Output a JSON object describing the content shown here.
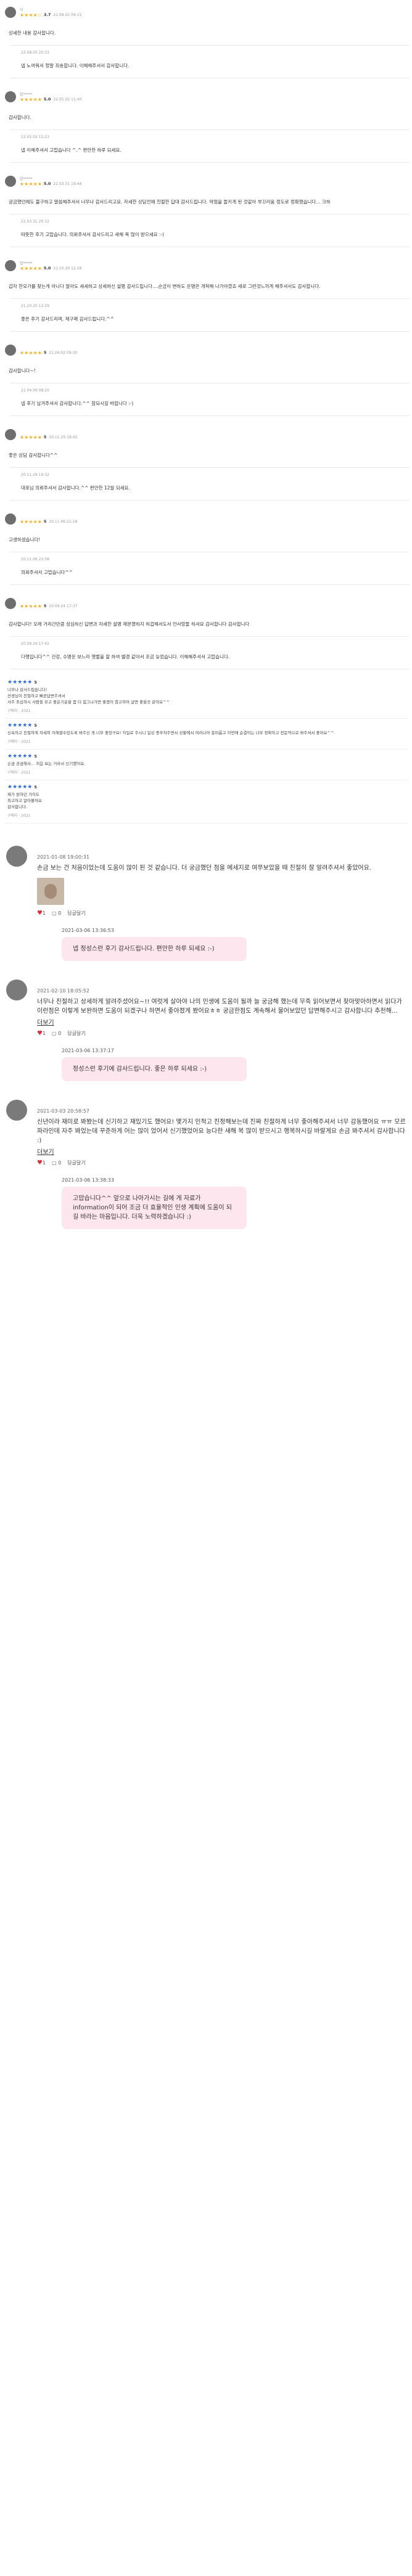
{
  "reviews": [
    {
      "user": "이",
      "stars": "★★★★☆",
      "score": "3.7",
      "date": "22.08.02 09:15",
      "text": "상세한 내용 감사합니다.",
      "reply_date": "22.08.03 20:33",
      "reply": "넵 노여워서 정말 죄송합니다. 이해해주셔서 감사합니다."
    },
    {
      "user": "밥*****",
      "stars": "★★★★★",
      "score": "5.0",
      "date": "22.05.02 11:40",
      "text": "감사합니다.",
      "reply_date": "22.05.02 12:23",
      "reply": "넵 이해주셔서 고맙습니다 ^.^ 편안한 하루 되세요."
    },
    {
      "user": "밥*****",
      "stars": "★★★★★",
      "score": "5.0",
      "date": "22.03.31 19:44",
      "text": "궁금했던에도 불구하고 말씀해주셔서 너무나 감사드리고요. 자세한 상담전에 친절한 답대 감사드립니다. 약점을 들키게 된 것같아 부끄러움 정도로 정확했습니다... 크하",
      "reply_date": "22.03.31 20:12",
      "reply": "따뜻한 후기 고맙습니다. 의뢰주셔서 감사드리고 새해 복 많이 받으세요 :-)"
    },
    {
      "user": "밥*****",
      "stars": "★★★★★",
      "score": "5.0",
      "date": "21.10.20 12:28",
      "text": "갑자 한모가를 찾는게 아니다 알아도 세세하고 상세하신 설명 감사드립니다....순금이 변하도 운명은 개척해 나가야겠죠 새로 그런것느끼게 해주셔서도 감사합니다.",
      "reply_date": "21.10.20 12:29",
      "reply": "좋은 후기 감사드리며, 재구매 감사드립니다.^^"
    },
    {
      "user": "",
      "stars": "★★★★★",
      "score": "5",
      "date": "21.04.02 09:30",
      "text": "감사합니다~!",
      "reply_date": "21.04.06 08:20",
      "reply": "넵 후기 남겨주셔서 감사합니다.^^ 참되시길 바랍니다 :-)"
    },
    {
      "user": "",
      "stars": "★★★★★",
      "score": "5",
      "date": "20.11.29 18:42",
      "text": "좋은 상담 감사합니다^^",
      "reply_date": "20.11.29 19:32",
      "reply": "대포님 의뢰주셔서 감사합니다.^^ 편안한 12월 되세요."
    },
    {
      "user": "",
      "stars": "★★★★★",
      "score": "5",
      "date": "20.11.06 21:18",
      "text": "고생하셨습니다!",
      "reply_date": "20.11.06 21:38",
      "reply": "의뢰주셔서 고맙습니다^^"
    },
    {
      "user": "",
      "stars": "★★★★★",
      "score": "5",
      "date": "20.09.24 17:37",
      "text": "감사합니다! 오래 거리간만큼 성심하신 답변과 자세한 설명 재문했하지 허겁해서도서 안사랑들 하셔요 감사합니다 감사합니다",
      "reply_date": "20.09.24 17:42",
      "reply": "다행입니다^^ 건강, 수명운 보느라 햇볕을 잘 하여 별경 같아서 조금 늦었습니다. 이해해주셔서 고맙습니다."
    }
  ],
  "cards": [
    {
      "stars": "★★★★★",
      "score": "5",
      "text": "너무나 감사드립습니다!\n선생님이 친절하고 빠른답변주셔서\n사주 조심하시 사람들 모고 좋은기운을 좀 더 힘그나가면 좋겠어 참고하여 살면 좋을것 같아요^^",
      "foot": "구매자 · 2021"
    },
    {
      "stars": "★★★★★",
      "score": "5",
      "text": "신속하고 친절하게 자세히 이해할수있도록 봐주신 게 너무 좋았구요! 자일로 주시니 일상 중후처주면서 상황에서 여러나아 흥미롭고 이번에 순결이는 너무 정확하고 전문적으로 봐주셔서 좋아요^^",
      "foot": "구매자 · 2021"
    },
    {
      "stars": "★★★★★",
      "score": "5",
      "text": "손금 궁금해서... 처음 보는 거라서 신기했어요.",
      "foot": "구매자 · 2021"
    },
    {
      "stars": "★★★★★",
      "score": "5",
      "text": "제가 원하던 가이도\n최고하고 알아볼까요\n감사합니다.",
      "foot": "구매자 · 2021"
    }
  ],
  "comments": [
    {
      "name": "",
      "date": "2021-01-08 19:00:31",
      "text": "손금 보는 건 처음이었는데 도움이 많이 된 것 같습니다. 더 궁금했던 점을 메세지로 여쭈보았을 때 친절히 잘 알려주셔서 좋았어요.",
      "has_image": true,
      "likes": "1",
      "count": "0",
      "reply_label": "답글달기",
      "reply_date": "2021-03-06 13:36:53",
      "reply": "넵 정성스런 후기 감사드립니다. 편안한 하루 되세요 :-)"
    },
    {
      "name": "",
      "date": "2021-02-10 18:05:52",
      "text": "너무나 친절하고 상세하게 알려주셨어요~!! 여럿게 살아야 나의 인생에 도움이 될까 늘 궁금해 했는데 무죽 읽어보면서 찾아맞아하면서 읽다가 이런점은 이렇게 보완하면 도움이 되겠구나 하면서 좋아졌게 봤어요ㅎㅎ 궁금한점도 계속해서 물어보았던 답변해주시고 감사합니다 추천해...",
      "more": "더보기",
      "has_image": false,
      "likes": "1",
      "count": "0",
      "reply_label": "답글달기",
      "reply_date": "2021-03-06 13:37:17",
      "reply": "정성스런 후기에 감사드립니다. 좋은 하루 되세요 :-)"
    },
    {
      "name": "",
      "date": "2021-03-03 20:58:57",
      "text": "신년이라 재미로 봐봤는데 신기하고 재밌기도 했어요! 몇가지 인적고 진정해보는데 진짜 친절하게 너무 좋아해주셔서 너무 감동했어요 ㅠㅠ 모르파라인데 자주 봐었는데 꾸준하게 어는 많이 었어서 신기했었어요 능다한 새해 복 많이 받으시고 행복하시길 바랄게요 손금 봐주셔서 감사합니다 :)",
      "more": "더보기",
      "has_image": false,
      "likes": "1",
      "count": "0",
      "reply_label": "답글달기",
      "reply_date": "2021-03-06 13:38:33",
      "reply": "고맙습니다^^ 앞으로 나아가시는 길에 게 자료가 information이 되어 조금 더 효율적인 인생 계획에 도움이 되길 바라는 마음입니다. 더욱 노력하겠습니다 :)"
    }
  ]
}
